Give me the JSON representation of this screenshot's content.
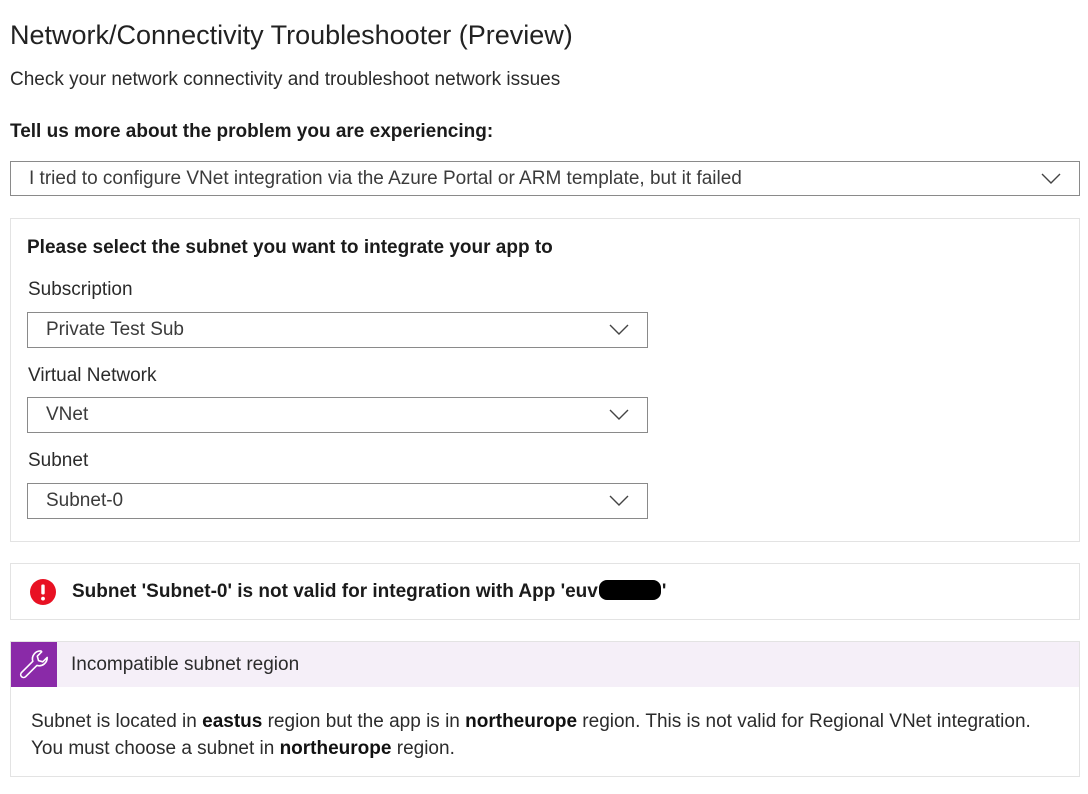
{
  "page": {
    "title": "Network/Connectivity Troubleshooter (Preview)",
    "subtitle": "Check your network connectivity and troubleshoot network issues"
  },
  "problem": {
    "question": "Tell us more about the problem you are experiencing:",
    "selected": "I tried to configure VNet integration via the Azure Portal or ARM template, but it failed"
  },
  "subnet_panel": {
    "heading": "Please select the subnet you want to integrate your app to",
    "subscription": {
      "label": "Subscription",
      "value": "Private Test Sub"
    },
    "virtual_network": {
      "label": "Virtual Network",
      "value": "VNet"
    },
    "subnet": {
      "label": "Subnet",
      "value": "Subnet-0"
    }
  },
  "error": {
    "icon": "error-circle-icon",
    "text_before": "Subnet 'Subnet-0' is not valid for integration with App 'euv",
    "text_after": "'",
    "color": "#e81123"
  },
  "recommendation": {
    "icon": "wrench-icon",
    "accent": "#8a2aa8",
    "title": "Incompatible subnet region",
    "body": {
      "p1": "Subnet is located in ",
      "region1": "eastus",
      "p2": " region but the app is in ",
      "region2": "northeurope",
      "p3": " region. This is not valid for Regional VNet integration. You must choose a subnet in ",
      "region3": "northeurope",
      "p4": " region."
    }
  }
}
